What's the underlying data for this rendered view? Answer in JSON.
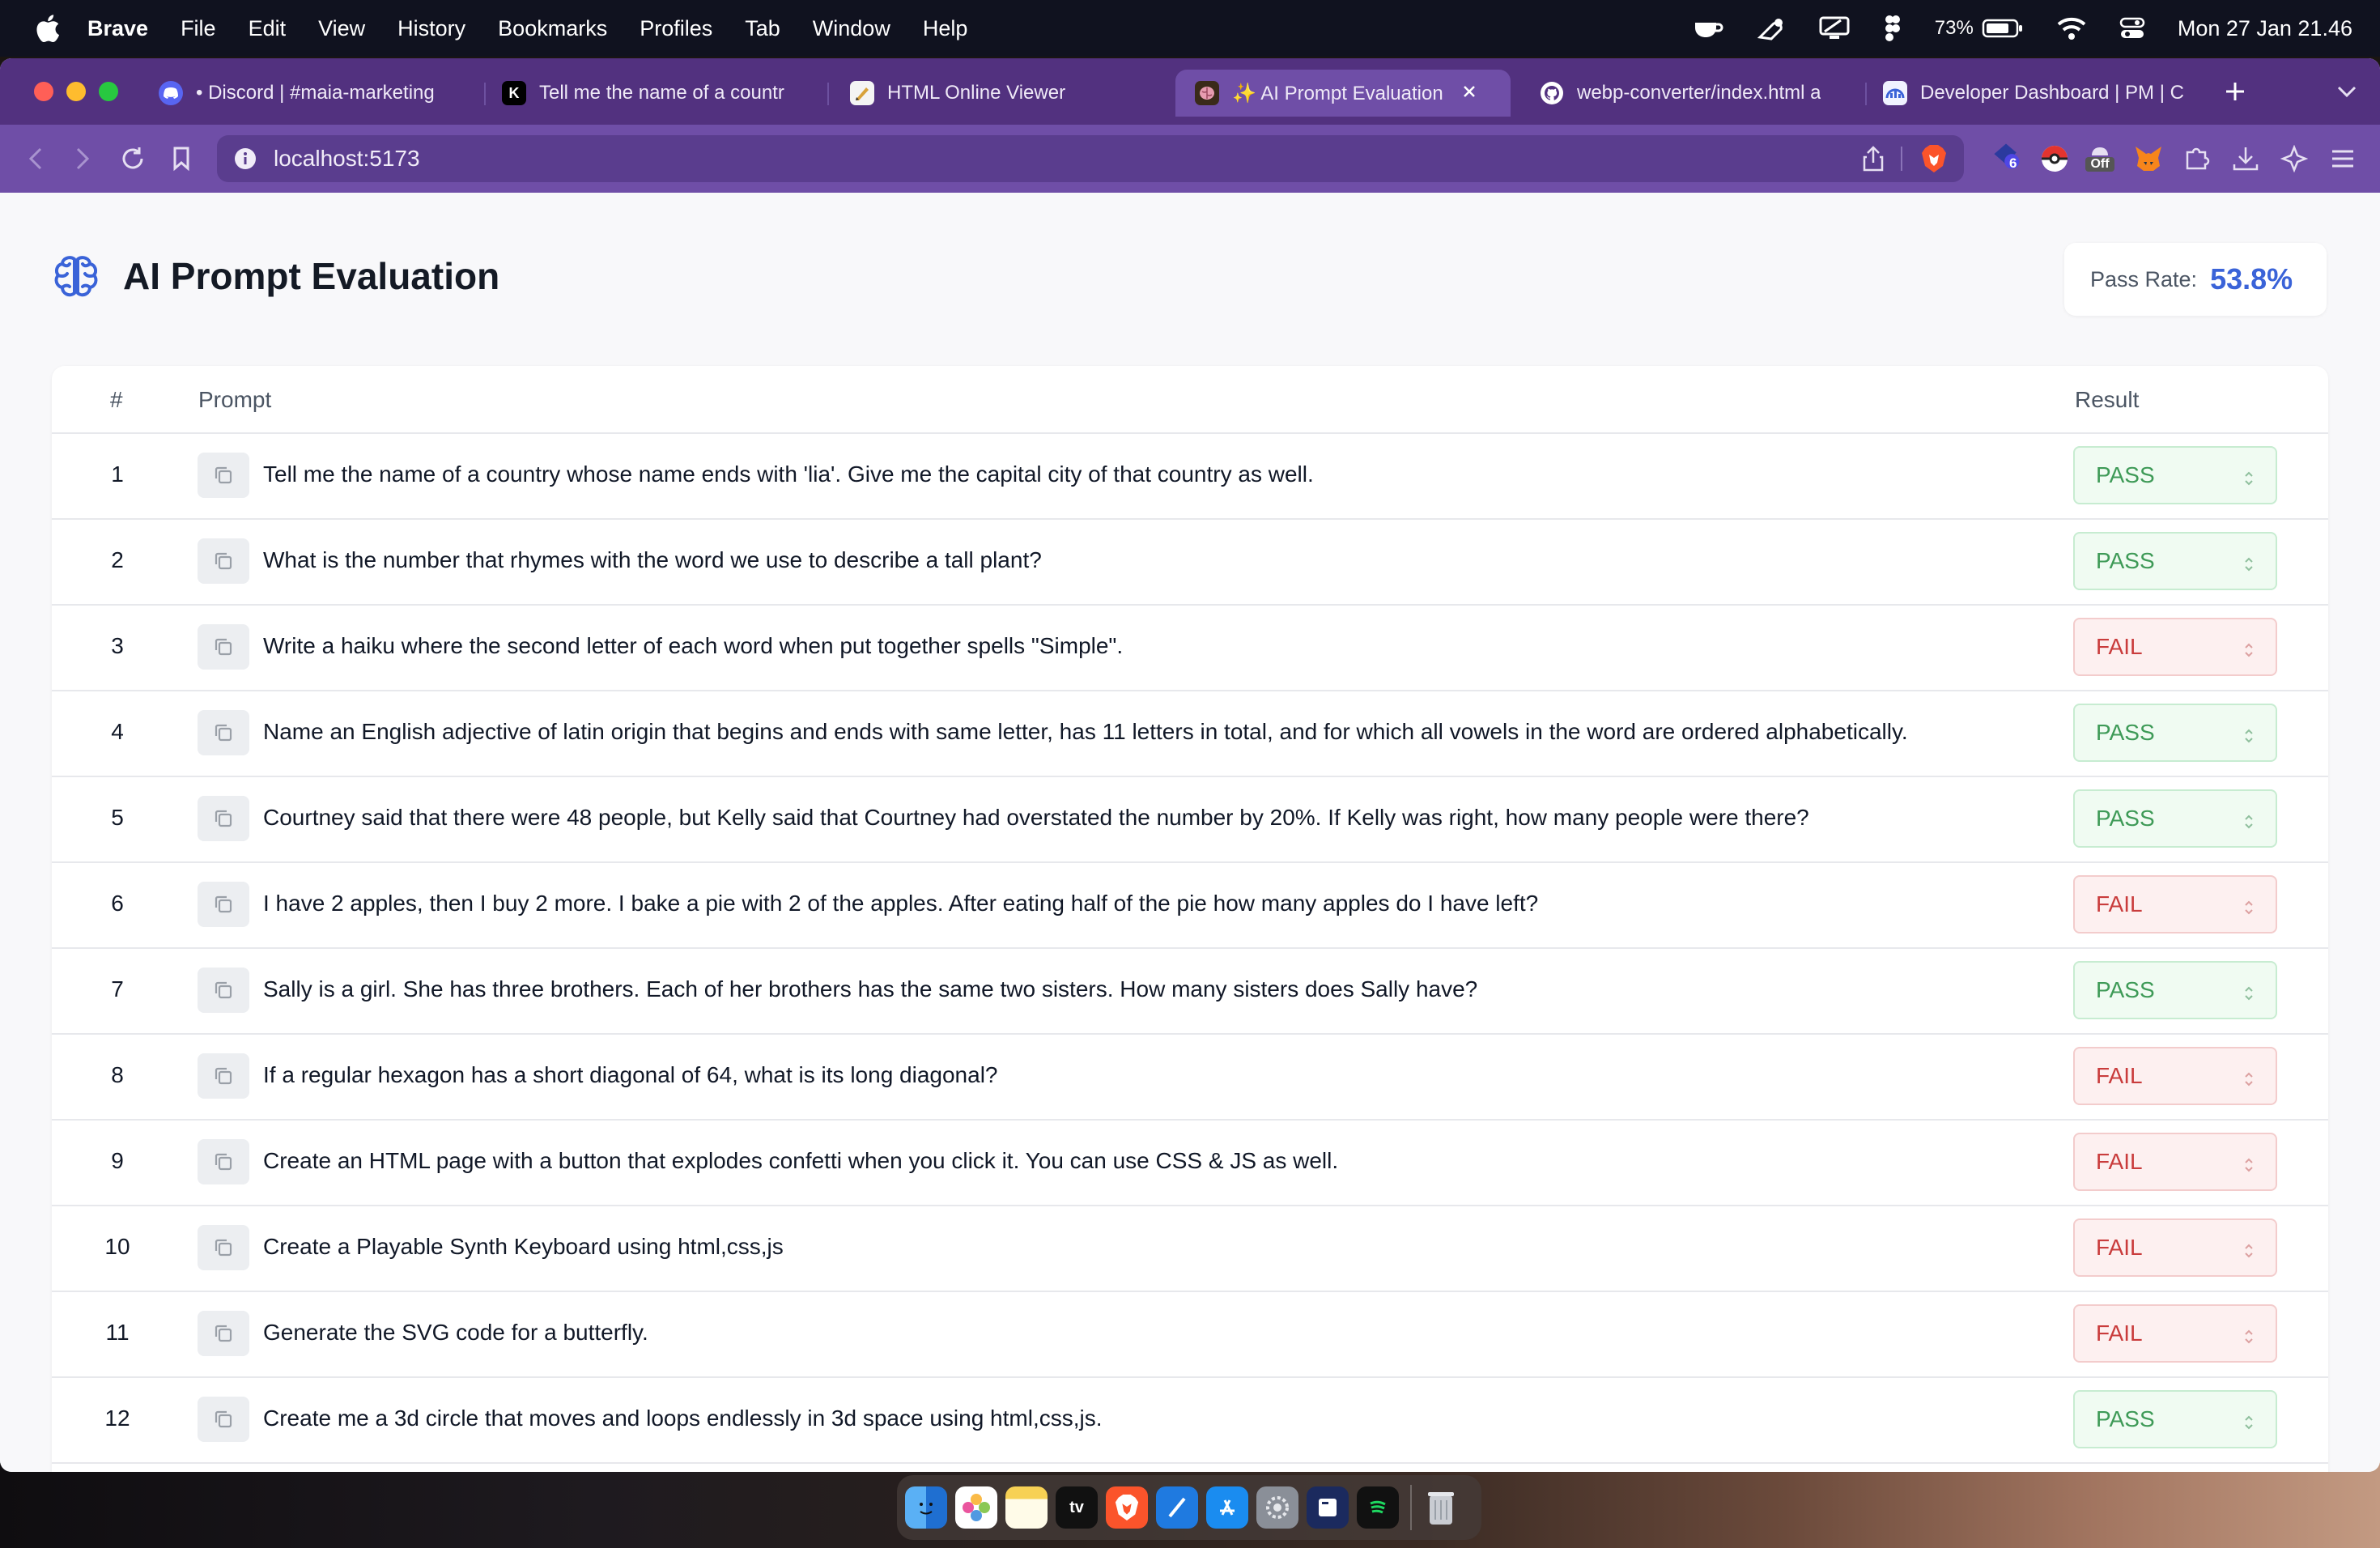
{
  "menubar": {
    "app_name": "Brave",
    "items": [
      "File",
      "Edit",
      "View",
      "History",
      "Bookmarks",
      "Profiles",
      "Tab",
      "Window",
      "Help"
    ],
    "battery_percent": "73%",
    "clock": "Mon 27 Jan  21.46"
  },
  "browser": {
    "tabs": [
      {
        "label": "• Discord | #maia-marketing",
        "icon": "discord-icon"
      },
      {
        "label": "Tell me the name of a countr",
        "icon": "k-app-icon"
      },
      {
        "label": "HTML Online Viewer",
        "icon": "html-viewer-icon"
      },
      {
        "label": "✨ AI Prompt Evaluation",
        "icon": "brain-favicon",
        "active": true
      },
      {
        "label": "webp-converter/index.html a",
        "icon": "github-icon"
      },
      {
        "label": "Developer Dashboard | PM | C",
        "icon": "dashboard-icon"
      }
    ],
    "url": "localhost:5173",
    "extension_badge": "6",
    "extension_off_label": "Off"
  },
  "page": {
    "title": "AI Prompt Evaluation",
    "pass_rate_label": "Pass Rate:",
    "pass_rate_value": "53.8%",
    "table": {
      "headers": {
        "num": "#",
        "prompt": "Prompt",
        "result": "Result"
      },
      "rows": [
        {
          "num": "1",
          "prompt": "Tell me the name of a country whose name ends with 'lia'. Give me the capital city of that country as well.",
          "result": "PASS"
        },
        {
          "num": "2",
          "prompt": "What is the number that rhymes with the word we use to describe a tall plant?",
          "result": "PASS"
        },
        {
          "num": "3",
          "prompt": "Write a haiku where the second letter of each word when put together spells \"Simple\".",
          "result": "FAIL"
        },
        {
          "num": "4",
          "prompt": "Name an English adjective of latin origin that begins and ends with same letter, has 11 letters in total, and for which all vowels in the word are ordered alphabetically.",
          "result": "PASS"
        },
        {
          "num": "5",
          "prompt": "Courtney said that there were 48 people, but Kelly said that Courtney had overstated the number by 20%. If Kelly was right, how many people were there?",
          "result": "PASS"
        },
        {
          "num": "6",
          "prompt": "I have 2 apples, then I buy 2 more. I bake a pie with 2 of the apples. After eating half of the pie how many apples do I have left?",
          "result": "FAIL"
        },
        {
          "num": "7",
          "prompt": "Sally is a girl. She has three brothers. Each of her brothers has the same two sisters. How many sisters does Sally have?",
          "result": "PASS"
        },
        {
          "num": "8",
          "prompt": "If a regular hexagon has a short diagonal of 64, what is its long diagonal?",
          "result": "FAIL"
        },
        {
          "num": "9",
          "prompt": "Create an HTML page with a button that explodes confetti when you click it. You can use CSS & JS as well.",
          "result": "FAIL"
        },
        {
          "num": "10",
          "prompt": "Create a Playable Synth Keyboard using html,css,js",
          "result": "FAIL"
        },
        {
          "num": "11",
          "prompt": "Generate the SVG code for a butterfly.",
          "result": "FAIL"
        },
        {
          "num": "12",
          "prompt": "Create me a 3d circle that moves and loops endlessly in 3d space using html,css,js.",
          "result": "PASS"
        }
      ]
    }
  },
  "dock": {
    "apps": [
      "finder-icon",
      "photos-icon",
      "notes-icon",
      "appletv-icon",
      "brave-icon",
      "xcode-icon",
      "appstore-icon",
      "system-settings-icon",
      "terminal-icon",
      "spotify-icon",
      "trash-icon"
    ],
    "appletv_label": "tv"
  },
  "colors": {
    "tabstrip": "#52317f",
    "toolbar": "#6f4ea7",
    "accent": "#3a63d8",
    "pass": "#3e9a57",
    "fail": "#c93c3c"
  }
}
